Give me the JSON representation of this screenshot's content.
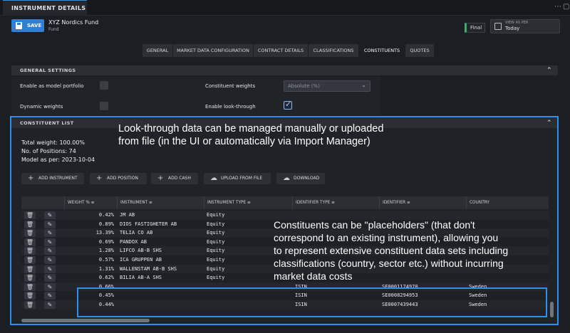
{
  "window": {
    "tab_title": "INSTRUMENT DETAILS",
    "ctrl_more": "⋯",
    "ctrl_max": "▢"
  },
  "header": {
    "save_label": "SAVE",
    "fund_name": "XYZ Nordics Fund",
    "fund_type": "Fund",
    "status_badge": "Final",
    "view_as_label": "VIEW AS PER",
    "view_as_value": "Today"
  },
  "tabs": [
    {
      "label": "GENERAL",
      "active": false
    },
    {
      "label": "MARKET DATA CONFIGURATION",
      "active": false
    },
    {
      "label": "CONTRACT DETAILS",
      "active": false
    },
    {
      "label": "CLASSIFICATIONS",
      "active": false
    },
    {
      "label": "CONSTITUENTS",
      "active": true
    },
    {
      "label": "QUOTES",
      "active": false
    }
  ],
  "general_settings": {
    "title": "GENERAL SETTINGS",
    "model_portfolio_label": "Enable as model portfolio",
    "model_portfolio_checked": false,
    "dynamic_weights_label": "Dynamic weights",
    "dynamic_weights_checked": false,
    "constituent_weights_label": "Constituent weights",
    "constituent_weights_value": "Absolute (%)",
    "look_through_label": "Enable look-through",
    "look_through_checked": true
  },
  "constituent_list": {
    "title": "CONSTITUENT LIST",
    "total_weight": "Total weight: 100.00%",
    "positions": "No. of Positions: 74",
    "model_as_per": "Model as per: 2023-10-04",
    "actions": [
      "ADD INSTRUMENT",
      "ADD POSITION",
      "ADD CASH",
      "UPLOAD FROM FILE",
      "DOWNLOAD"
    ],
    "columns": [
      "WEIGHT %",
      "INSTRUMENT",
      "INSTRUMENT TYPE",
      "IDENTIFIER TYPE",
      "IDENTIFIER",
      "COUNTRY"
    ],
    "rows": [
      {
        "weight": "0.42%",
        "instrument": "JM AB",
        "type": "Equity",
        "id_type": "",
        "identifier": "",
        "country": ""
      },
      {
        "weight": "0.89%",
        "instrument": "DIOS FASTIGHETER AB",
        "type": "Equity",
        "id_type": "",
        "identifier": "",
        "country": ""
      },
      {
        "weight": "13.39%",
        "instrument": "TELIA CO AB",
        "type": "Equity",
        "id_type": "",
        "identifier": "",
        "country": ""
      },
      {
        "weight": "0.69%",
        "instrument": "PANDOX AB",
        "type": "Equity",
        "id_type": "",
        "identifier": "",
        "country": ""
      },
      {
        "weight": "1.28%",
        "instrument": "LIFCO AB-B SHS",
        "type": "Equity",
        "id_type": "",
        "identifier": "",
        "country": ""
      },
      {
        "weight": "0.57%",
        "instrument": "ICA GRUPPEN AB",
        "type": "Equity",
        "id_type": "",
        "identifier": "",
        "country": ""
      },
      {
        "weight": "1.31%",
        "instrument": "WALLENSTAM AB-B SHS",
        "type": "Equity",
        "id_type": "",
        "identifier": "",
        "country": ""
      },
      {
        "weight": "0.62%",
        "instrument": "BILIA AB-A SHS",
        "type": "Equity",
        "id_type": "",
        "identifier": "",
        "country": ""
      },
      {
        "weight": "0.66%",
        "instrument": "",
        "type": "",
        "id_type": "ISIN",
        "identifier": "SE0001174970",
        "country": "Sweden"
      },
      {
        "weight": "0.45%",
        "instrument": "",
        "type": "",
        "id_type": "ISIN",
        "identifier": "SE0008294953",
        "country": "Sweden"
      },
      {
        "weight": "0.44%",
        "instrument": "",
        "type": "",
        "id_type": "ISIN",
        "identifier": "SE0007439443",
        "country": "Sweden"
      }
    ]
  },
  "annotations": {
    "top": "Look-through data can be managed manually or uploaded from file (in the UI or automatically via Import Manager)",
    "middle": "Constituents can be \"placeholders\" (that don't correspond to an existing instrument), allowing you to represent extensive constituent data sets including classifications (country, sector etc.) without incurring market data costs"
  },
  "colors": {
    "accent": "#2f7fd3",
    "highlight": "#2e8ff0",
    "final": "#3fae6a"
  }
}
